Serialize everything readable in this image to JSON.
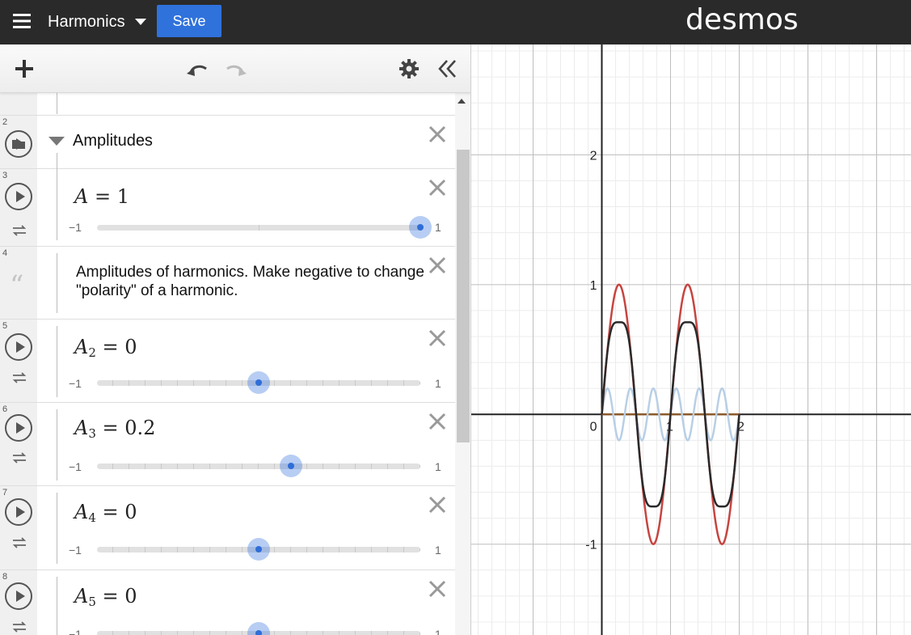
{
  "header": {
    "title": "Harmonics",
    "save_label": "Save",
    "brand": "desmos"
  },
  "expressions": [
    {
      "number": "2",
      "type": "folder",
      "title": "Amplitudes"
    },
    {
      "number": "3",
      "type": "slider",
      "var": "A",
      "sub": "",
      "value": "1",
      "min": "−1",
      "max": "1",
      "fraction": 1.0
    },
    {
      "number": "4",
      "type": "note",
      "text": "Amplitudes of harmonics. Make negative to change \"polarity\" of a harmonic."
    },
    {
      "number": "5",
      "type": "slider",
      "var": "A",
      "sub": "2",
      "value": "0",
      "min": "−1",
      "max": "1",
      "fraction": 0.5
    },
    {
      "number": "6",
      "type": "slider",
      "var": "A",
      "sub": "3",
      "value": "0.2",
      "min": "−1",
      "max": "1",
      "fraction": 0.6
    },
    {
      "number": "7",
      "type": "slider",
      "var": "A",
      "sub": "4",
      "value": "0",
      "min": "−1",
      "max": "1",
      "fraction": 0.5
    },
    {
      "number": "8",
      "type": "slider",
      "var": "A",
      "sub": "5",
      "value": "0",
      "min": "−1",
      "max": "1",
      "fraction": 0.5
    }
  ],
  "graph": {
    "x_range": [
      -1.9,
      4.5
    ],
    "y_range": [
      -1.7,
      2.85
    ],
    "x_tick_labels": [
      "1",
      "2"
    ],
    "y_tick_labels": [
      "2",
      "1",
      "-1"
    ],
    "origin_label": "0",
    "colors": {
      "fundamental": "#c74440",
      "harmonic3": "#b8cfe6",
      "sum": "#2a2a2a",
      "zero_line": "#8b5a2b",
      "axis": "#222222",
      "major_grid": "#bdbdbd",
      "minor_grid": "#ececec"
    },
    "curves": [
      {
        "name": "fundamental",
        "expression": "A·sin(πx)"
      },
      {
        "name": "harmonic3",
        "expression": "A3·sin(3·... )"
      },
      {
        "name": "sum",
        "expression": "sum of harmonics"
      }
    ]
  },
  "icons": {
    "menu": "hamburger-menu-icon",
    "add": "plus-icon",
    "undo": "undo-icon",
    "redo": "redo-icon",
    "settings": "gear-icon",
    "collapse": "double-chevron-left-icon"
  }
}
